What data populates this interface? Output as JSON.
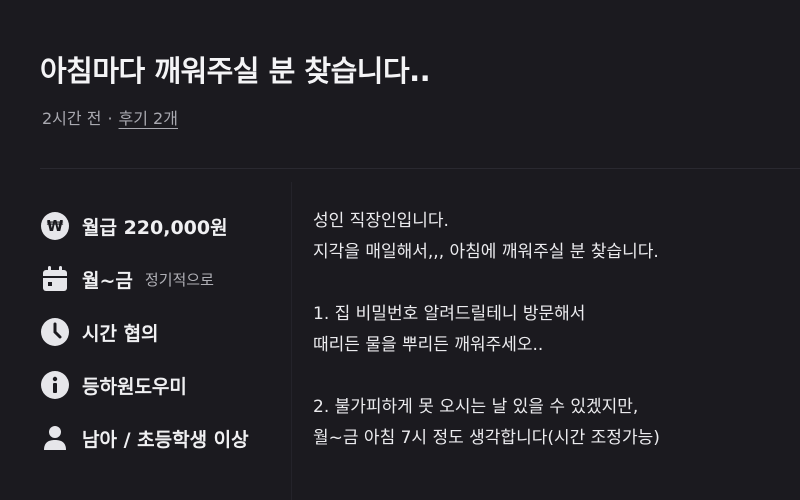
{
  "post": {
    "title": "아침마다 깨워주실 분 찾습니다..",
    "time_ago": "2시간 전",
    "separator": "·",
    "reviews_link": "후기 2개"
  },
  "info": {
    "wage": "월급 220,000원",
    "days": "월~금",
    "days_note": "정기적으로",
    "hours": "시간 협의",
    "category": "등하원도우미",
    "target": "남아 / 초등학생 이상"
  },
  "icons": {
    "wage": "won-icon",
    "days": "calendar-icon",
    "hours": "clock-icon",
    "category": "info-icon",
    "target": "person-icon"
  },
  "description": {
    "line1": "성인 직장인입니다.",
    "line2": "지각을 매일해서,,, 아침에 깨워주실 분 찾습니다.",
    "line3": "1. 집 비밀번호 알려드릴테니 방문해서",
    "line4": "때리든 물을 뿌리든 깨워주세오..",
    "line5": "2. 불가피하게 못 오시는 날 있을 수 있겠지만,",
    "line6": "월~금 아침 7시 정도 생각합니다(시간 조정가능)"
  }
}
